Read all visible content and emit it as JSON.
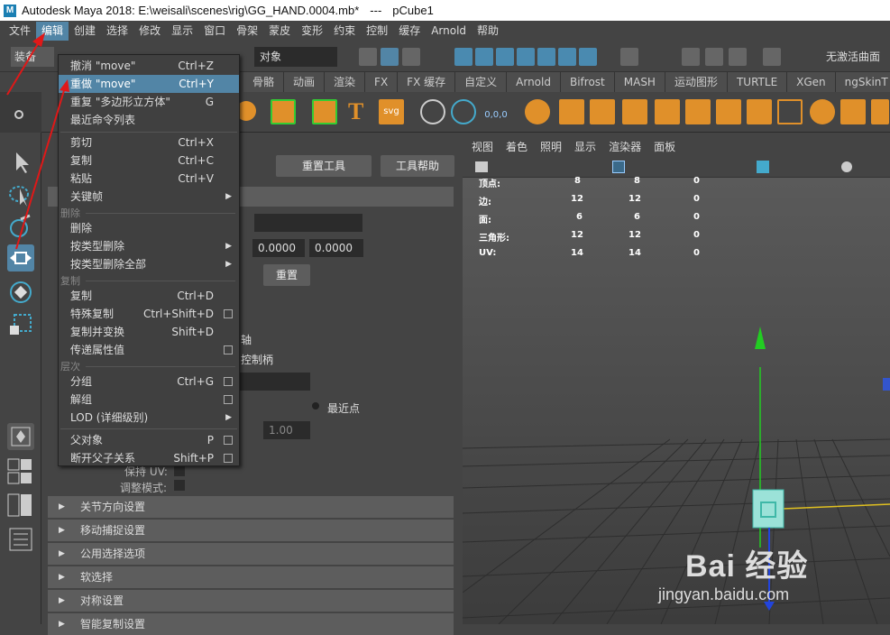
{
  "titlebar": {
    "app": "Autodesk Maya 2018: E:\\weisali\\scenes\\rig\\GG_HAND.0004.mb*",
    "sep": "---",
    "object": "pCube1"
  },
  "menubar": [
    "文件",
    "编辑",
    "创建",
    "选择",
    "修改",
    "显示",
    "窗口",
    "骨架",
    "蒙皮",
    "变形",
    "约束",
    "控制",
    "缓存",
    "Arnold",
    "帮助"
  ],
  "shelf_row": {
    "menuset": "装备",
    "object_field": "对象",
    "live_surface": "无激活曲面"
  },
  "shelf_tabs": [
    "骨骼",
    "动画",
    "渲染",
    "FX",
    "FX 缓存",
    "自定义",
    "Arnold",
    "Bifrost",
    "MASH",
    "运动图形",
    "TURTLE",
    "XGen",
    "ngSkinT"
  ],
  "attr_panel": {
    "reset_tool": "重置工具",
    "tool_help": "工具帮助",
    "values": [
      "0.0000",
      "0.0000"
    ],
    "reset": "重置",
    "axis_suffix": "轴",
    "handle_suffix": "控制柄",
    "nearest_point": "最近点",
    "value_100": "1.00",
    "keep_uv": "保持 UV:",
    "adjust_mode": "调整模式:",
    "sections": [
      "关节方向设置",
      "移动捕捉设置",
      "公用选择选项",
      "软选择",
      "对称设置",
      "智能复制设置"
    ]
  },
  "viewport": {
    "menu": [
      "视图",
      "着色",
      "照明",
      "显示",
      "渲染器",
      "面板"
    ],
    "hud": [
      {
        "label": "顶点:",
        "a": "8",
        "b": "8",
        "c": "0"
      },
      {
        "label": "边:",
        "a": "12",
        "b": "12",
        "c": "0"
      },
      {
        "label": "面:",
        "a": "6",
        "b": "6",
        "c": "0"
      },
      {
        "label": "三角形:",
        "a": "12",
        "b": "12",
        "c": "0"
      },
      {
        "label": "UV:",
        "a": "14",
        "b": "14",
        "c": "0"
      }
    ]
  },
  "edit_menu": {
    "items": [
      {
        "label": "撤消 \"move\"",
        "shortcut": "Ctrl+Z"
      },
      {
        "label": "重做 \"move\"",
        "shortcut": "Ctrl+Y",
        "highlight": true
      },
      {
        "label": "重复 \"多边形立方体\"",
        "shortcut": "G"
      },
      {
        "label": "最近命令列表",
        "shortcut": ""
      },
      {
        "label": "剪切",
        "shortcut": "Ctrl+X"
      },
      {
        "label": "复制",
        "shortcut": "Ctrl+C"
      },
      {
        "label": "粘贴",
        "shortcut": "Ctrl+V"
      },
      {
        "label": "关键帧",
        "shortcut": ""
      },
      {
        "label": "删除",
        "shortcut": ""
      },
      {
        "label": "按类型删除",
        "shortcut": ""
      },
      {
        "label": "按类型删除全部",
        "shortcut": ""
      },
      {
        "label": "复制",
        "shortcut": "Ctrl+D"
      },
      {
        "label": "特殊复制",
        "shortcut": "Ctrl+Shift+D"
      },
      {
        "label": "复制并变换",
        "shortcut": "Shift+D"
      },
      {
        "label": "传递属性值",
        "shortcut": ""
      },
      {
        "label": "分组",
        "shortcut": "Ctrl+G"
      },
      {
        "label": "解组",
        "shortcut": ""
      },
      {
        "label": "LOD (详细级别)",
        "shortcut": ""
      },
      {
        "label": "父对象",
        "shortcut": "P"
      },
      {
        "label": "断开父子关系",
        "shortcut": "Shift+P"
      }
    ],
    "section_delete": "删除",
    "section_duplicate": "复制",
    "section_hierarchy": "层次"
  },
  "watermark": {
    "brand": "Bai 经验",
    "url": "jingyan.baidu.com"
  },
  "colors": {
    "highlight": "#5285a6",
    "annotation": "#e01818",
    "y_axis": "#22cc22",
    "x_axis": "#e0c020"
  }
}
